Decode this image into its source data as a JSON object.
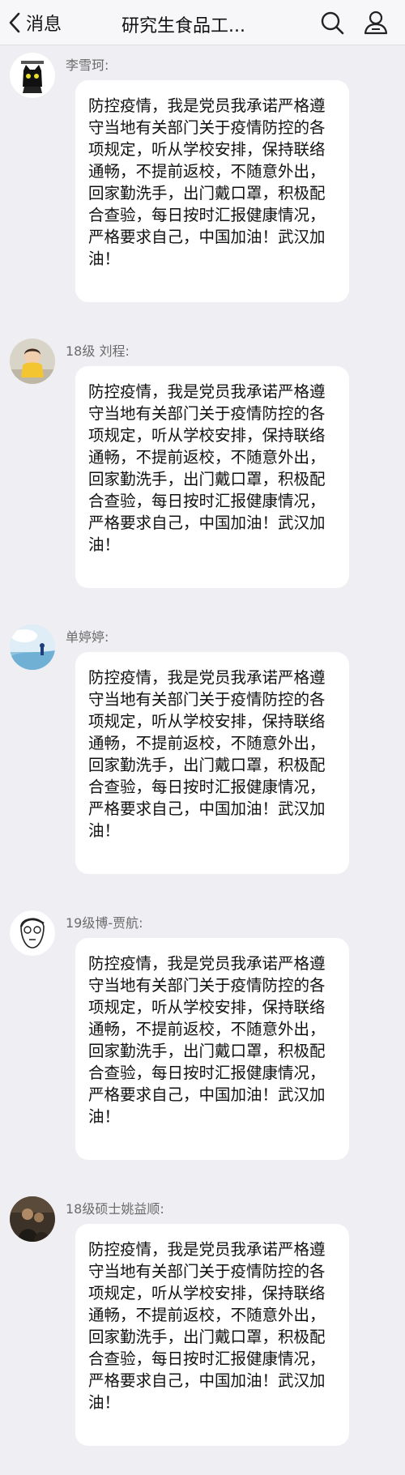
{
  "header": {
    "back_label": "消息",
    "title": "研究生食品工...",
    "search_icon": "search-icon",
    "profile_icon": "user-icon"
  },
  "messages": [
    {
      "sender": "李雪珂:",
      "avatar": "cat-avatar",
      "text": "防控疫情，我是党员我承诺严格遵守当地有关部门关于疫情防控的各项规定，听从学校安排，保持联络通畅，不提前返校，不随意外出，回家勤洗手，出门戴口罩，积极配合查验，每日按时汇报健康情况，严格要求自己，中国加油！武汉加油！"
    },
    {
      "sender": "18级 刘程:",
      "avatar": "child-avatar",
      "text": "防控疫情，我是党员我承诺严格遵守当地有关部门关于疫情防控的各项规定，听从学校安排，保持联络通畅，不提前返校，不随意外出，回家勤洗手，出门戴口罩，积极配合查验，每日按时汇报健康情况，严格要求自己，中国加油！武汉加油！"
    },
    {
      "sender": "单婷婷:",
      "avatar": "sky-avatar",
      "text": "防控疫情，我是党员我承诺严格遵守当地有关部门关于疫情防控的各项规定，听从学校安排，保持联络通畅，不提前返校，不随意外出，回家勤洗手，出门戴口罩，积极配合查验，每日按时汇报健康情况，严格要求自己，中国加油！武汉加油！"
    },
    {
      "sender": "19级博-贾航:",
      "avatar": "sketch-face-avatar",
      "text": "防控疫情，我是党员我承诺严格遵守当地有关部门关于疫情防控的各项规定，听从学校安排，保持联络通畅，不提前返校，不随意外出，回家勤洗手，出门戴口罩，积极配合查验，每日按时汇报健康情况，严格要求自己，中国加油！武汉加油！"
    },
    {
      "sender": "18级硕士姚益顺:",
      "avatar": "photo-avatar",
      "text": "防控疫情，我是党员我承诺严格遵守当地有关部门关于疫情防控的各项规定，听从学校安排，保持联络通畅，不提前返校，不随意外出，回家勤洗手，出门戴口罩，积极配合查验，每日按时汇报健康情况，严格要求自己，中国加油！武汉加油！"
    }
  ]
}
